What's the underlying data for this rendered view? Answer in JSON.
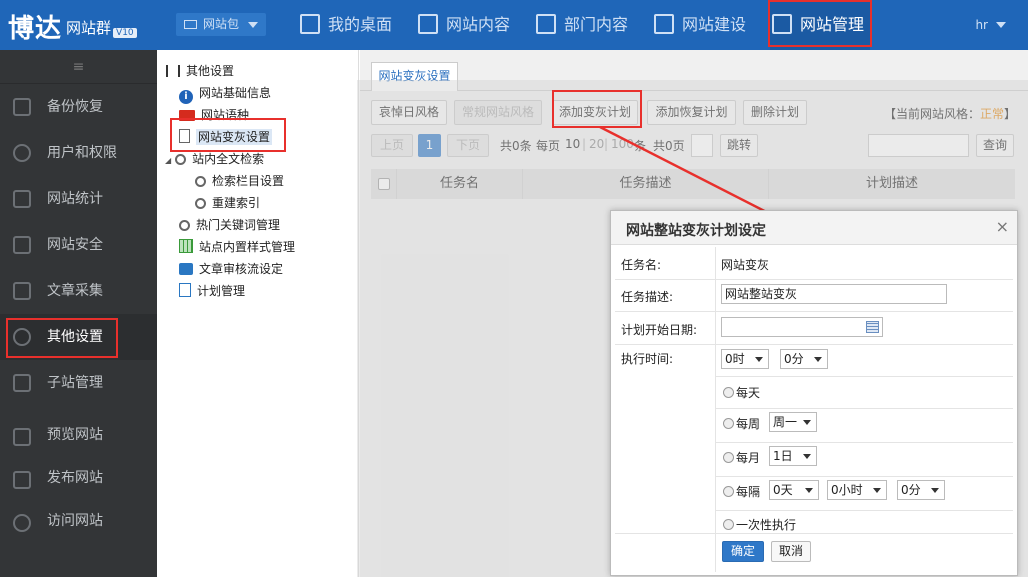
{
  "header": {
    "logo_main": "博达",
    "logo_sub": "网站群",
    "version": "V10",
    "site_switch": "网站包",
    "nav": [
      "我的桌面",
      "网站内容",
      "部门内容",
      "网站建设",
      "网站管理"
    ],
    "user": "hr"
  },
  "sidebar": {
    "collapse_icon": "≡",
    "items": [
      "备份恢复",
      "用户和权限",
      "网站统计",
      "网站安全",
      "文章采集",
      "其他设置",
      "子站管理"
    ],
    "bottom_items": [
      "预览网站",
      "发布网站",
      "访问网站"
    ],
    "active": "其他设置"
  },
  "tree": {
    "root": "其他设置",
    "items": [
      "网站基础信息",
      "网站语种",
      "网站变灰设置",
      "站内全文检索",
      "检索栏目设置",
      "重建索引",
      "热门关键词管理",
      "站点内置样式管理",
      "文章审核流设定",
      "计划管理"
    ]
  },
  "main": {
    "tab": "网站变灰设置",
    "buttons": [
      "哀悼日风格",
      "常规网站风格",
      "添加变灰计划",
      "添加恢复计划",
      "删除计划"
    ],
    "current_style_label": "【当前网站风格：",
    "current_style_value": "正常",
    "current_style_end": "】",
    "pager": {
      "prev": "上页",
      "page": "1",
      "next": "下页",
      "total": "共0条",
      "per_page_label": "每页",
      "sizes": [
        "10",
        "20",
        "100"
      ],
      "per_page_unit": "条",
      "pages": "共0页",
      "jump": "跳转",
      "query": "查询"
    },
    "columns": [
      "任务名",
      "任务描述",
      "计划描述"
    ]
  },
  "modal": {
    "title": "网站整站变灰计划设定",
    "close": "×",
    "task_name_label": "任务名:",
    "task_name_value": "网站变灰",
    "task_desc_label": "任务描述:",
    "task_desc_value": "网站整站变灰",
    "start_date_label": "计划开始日期:",
    "start_date_value": "",
    "exec_time_label": "执行时间:",
    "hour": "0时",
    "minute": "0分",
    "daily": "每天",
    "weekly": "每周",
    "weekday": "周一",
    "monthly": "每月",
    "monthday": "1日",
    "interval": "每隔",
    "interval_day": "0天",
    "interval_hour": "0小时",
    "interval_minute": "0分",
    "once": "一次性执行",
    "ok": "确定",
    "cancel": "取消"
  },
  "colors": {
    "topbar": "#1f66b8",
    "sidebar": "#333537",
    "highlight": "#e8302c",
    "primary": "#2f78c8",
    "accent": "#e5860a"
  }
}
